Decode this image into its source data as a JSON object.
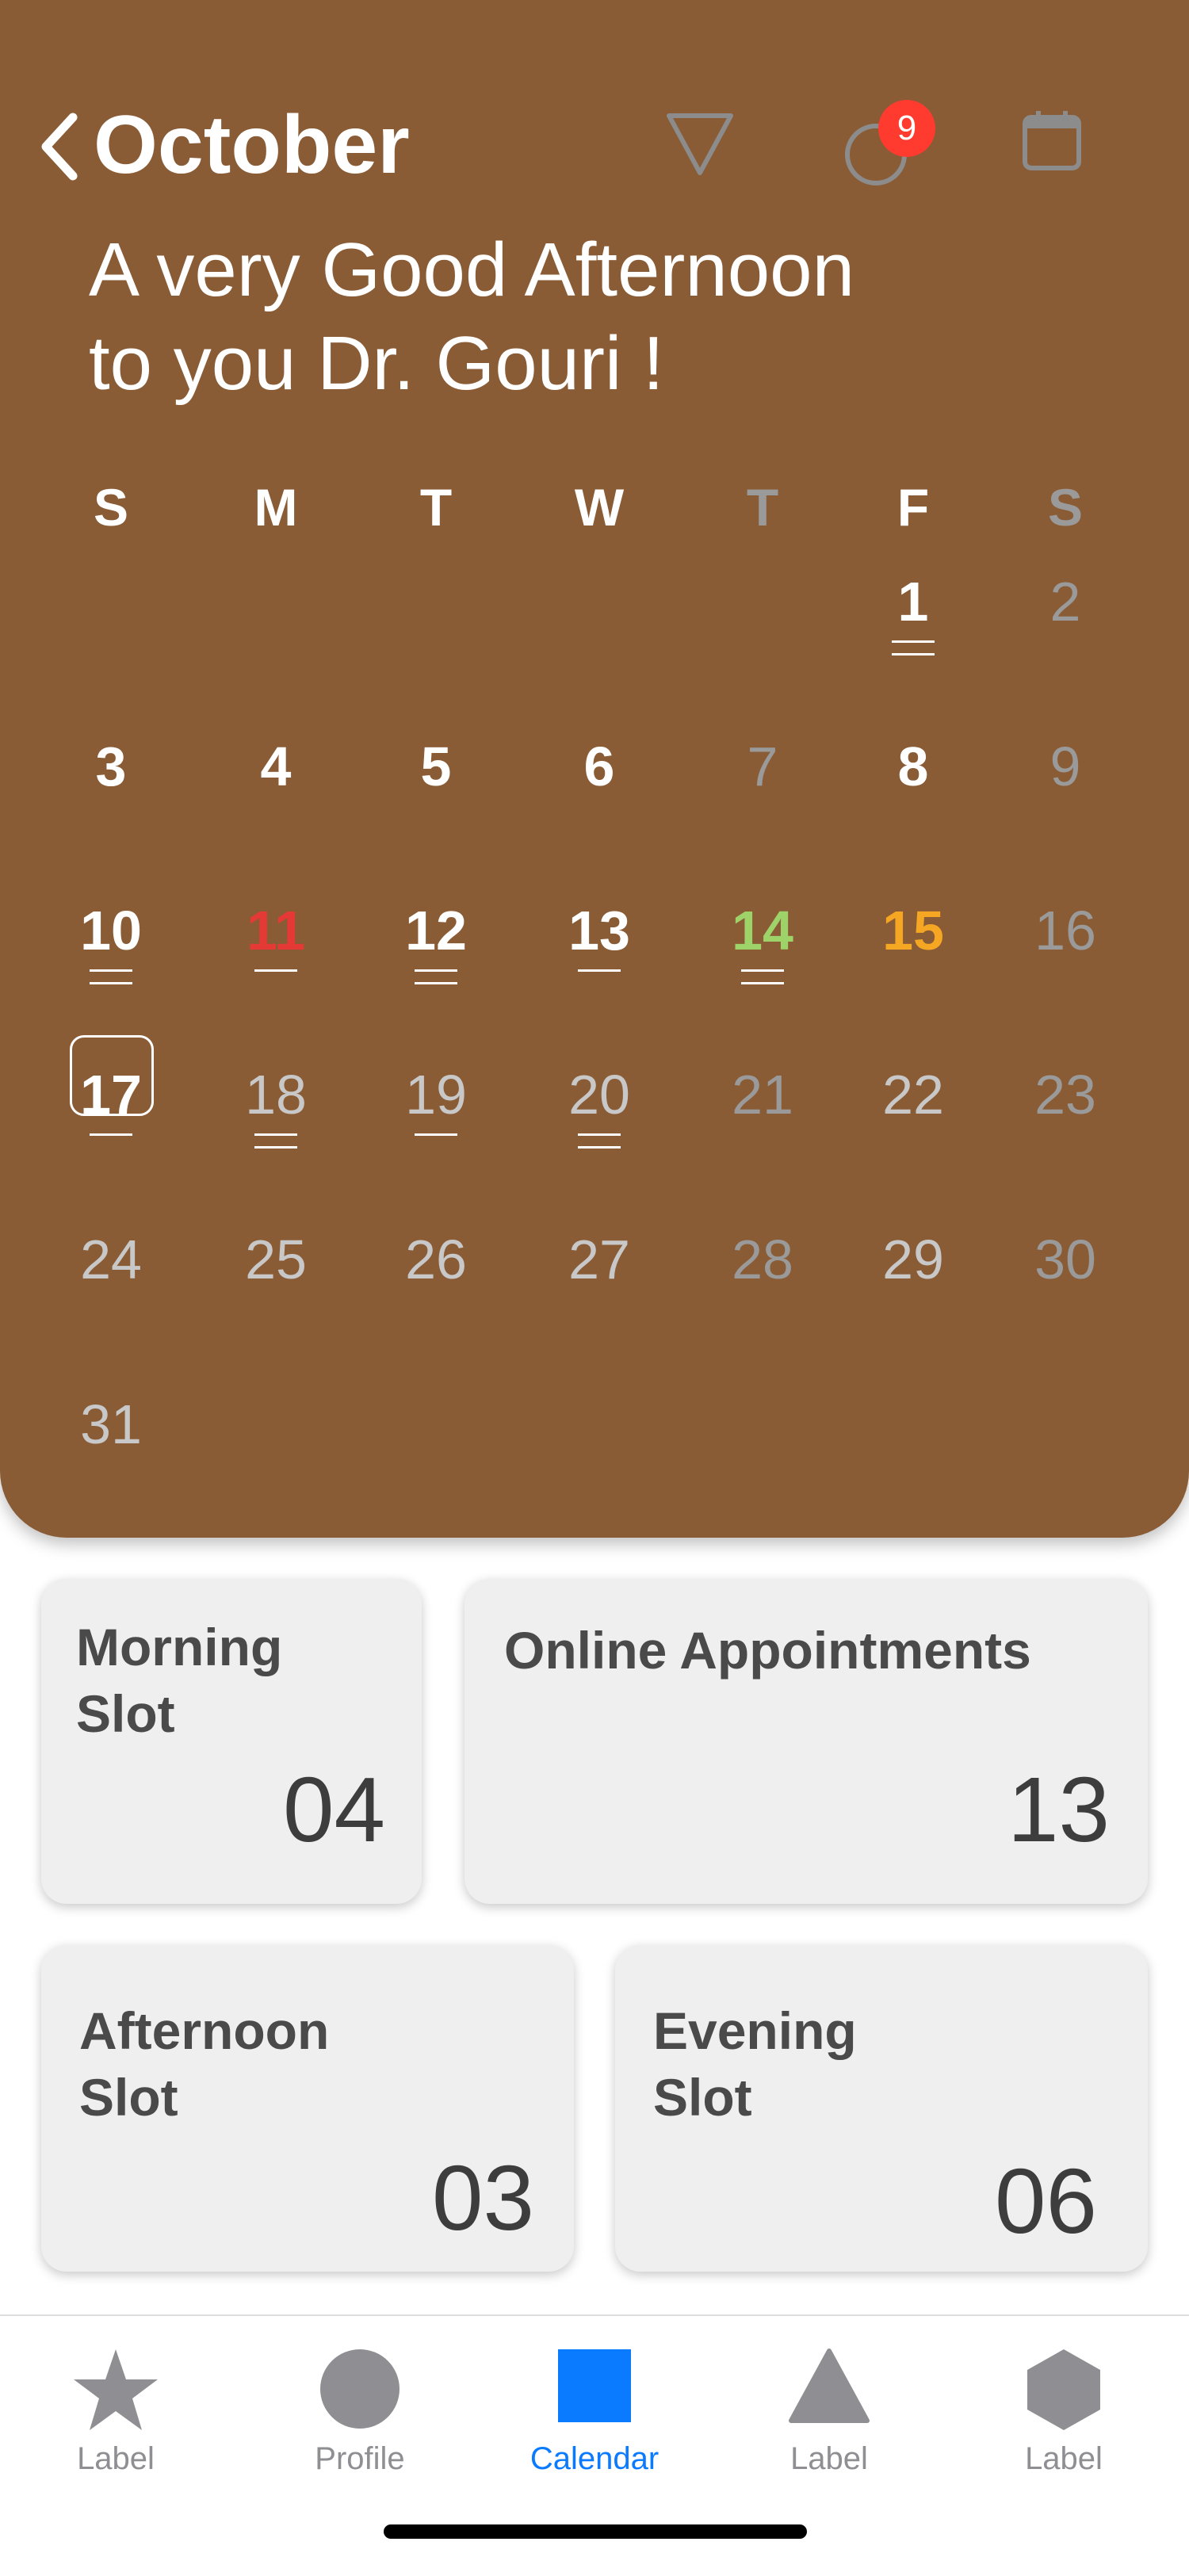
{
  "header": {
    "month": "October",
    "notification_count": "9",
    "greeting_line1": "A very Good Afternoon",
    "greeting_line2": "to you Dr. Gouri !"
  },
  "weekdays": [
    {
      "label": "S",
      "color": "#ffffff"
    },
    {
      "label": "M",
      "color": "#ffffff"
    },
    {
      "label": "T",
      "color": "#ffffff"
    },
    {
      "label": "W",
      "color": "#ffffff"
    },
    {
      "label": "T",
      "color": "#9a9a9a"
    },
    {
      "label": "F",
      "color": "#ffffff"
    },
    {
      "label": "S",
      "color": "#9a9a9a"
    }
  ],
  "days": [
    {
      "n": "1",
      "color": "#ffffff",
      "strong": true,
      "marks": 2
    },
    {
      "n": "2",
      "color": "#9a9a9a",
      "strong": false,
      "marks": 0
    },
    {
      "n": "3",
      "color": "#ffffff",
      "strong": true,
      "marks": 0
    },
    {
      "n": "4",
      "color": "#ffffff",
      "strong": true,
      "marks": 0
    },
    {
      "n": "5",
      "color": "#ffffff",
      "strong": true,
      "marks": 0
    },
    {
      "n": "6",
      "color": "#ffffff",
      "strong": true,
      "marks": 0
    },
    {
      "n": "7",
      "color": "#9a9a9a",
      "strong": false,
      "marks": 0
    },
    {
      "n": "8",
      "color": "#ffffff",
      "strong": true,
      "marks": 0
    },
    {
      "n": "9",
      "color": "#9a9a9a",
      "strong": false,
      "marks": 0
    },
    {
      "n": "10",
      "color": "#ffffff",
      "strong": true,
      "marks": 2
    },
    {
      "n": "11",
      "color": "#e53935",
      "strong": true,
      "marks": 1
    },
    {
      "n": "12",
      "color": "#ffffff",
      "strong": true,
      "marks": 2
    },
    {
      "n": "13",
      "color": "#ffffff",
      "strong": true,
      "marks": 1
    },
    {
      "n": "14",
      "color": "#9ed36a",
      "strong": true,
      "marks": 2
    },
    {
      "n": "15",
      "color": "#f5a623",
      "strong": true,
      "marks": 0
    },
    {
      "n": "16",
      "color": "#9a9a9a",
      "strong": false,
      "marks": 0
    },
    {
      "n": "17",
      "color": "#ffffff",
      "strong": true,
      "marks": 1,
      "today": true
    },
    {
      "n": "18",
      "color": "#c8c8c8",
      "strong": false,
      "marks": 2
    },
    {
      "n": "19",
      "color": "#c8c8c8",
      "strong": false,
      "marks": 1
    },
    {
      "n": "20",
      "color": "#c8c8c8",
      "strong": false,
      "marks": 2
    },
    {
      "n": "21",
      "color": "#9a9a9a",
      "strong": false,
      "marks": 0
    },
    {
      "n": "22",
      "color": "#c8c8c8",
      "strong": false,
      "marks": 0
    },
    {
      "n": "23",
      "color": "#9a9a9a",
      "strong": false,
      "marks": 0
    },
    {
      "n": "24",
      "color": "#c8c8c8",
      "strong": false,
      "marks": 0
    },
    {
      "n": "25",
      "color": "#c8c8c8",
      "strong": false,
      "marks": 0
    },
    {
      "n": "26",
      "color": "#c8c8c8",
      "strong": false,
      "marks": 0
    },
    {
      "n": "27",
      "color": "#c8c8c8",
      "strong": false,
      "marks": 0
    },
    {
      "n": "28",
      "color": "#9a9a9a",
      "strong": false,
      "marks": 0
    },
    {
      "n": "29",
      "color": "#c8c8c8",
      "strong": false,
      "marks": 0
    },
    {
      "n": "30",
      "color": "#9a9a9a",
      "strong": false,
      "marks": 0
    },
    {
      "n": "31",
      "color": "#c8c8c8",
      "strong": false,
      "marks": 0
    }
  ],
  "slots": {
    "morning": {
      "title1": "Morning",
      "title2": "Slot",
      "count": "04"
    },
    "online": {
      "title": "Online Appointments",
      "count": "13"
    },
    "afternoon": {
      "title1": "Afternoon",
      "title2": "Slot",
      "count": "03"
    },
    "evening": {
      "title1": "Evening",
      "title2": "Slot",
      "count": "06"
    }
  },
  "tabs": [
    {
      "label": "Label",
      "icon": "star-icon",
      "active": false
    },
    {
      "label": "Profile",
      "icon": "circle-icon",
      "active": false
    },
    {
      "label": "Calendar",
      "icon": "square-icon",
      "active": true
    },
    {
      "label": "Label",
      "icon": "triangle-icon",
      "active": false
    },
    {
      "label": "Label",
      "icon": "hexagon-icon",
      "active": false
    }
  ],
  "colors": {
    "header_bg": "#8a5c36",
    "active_tab": "#0a7aff",
    "inactive_tab": "#8e8e93",
    "badge": "#ff3b30"
  }
}
